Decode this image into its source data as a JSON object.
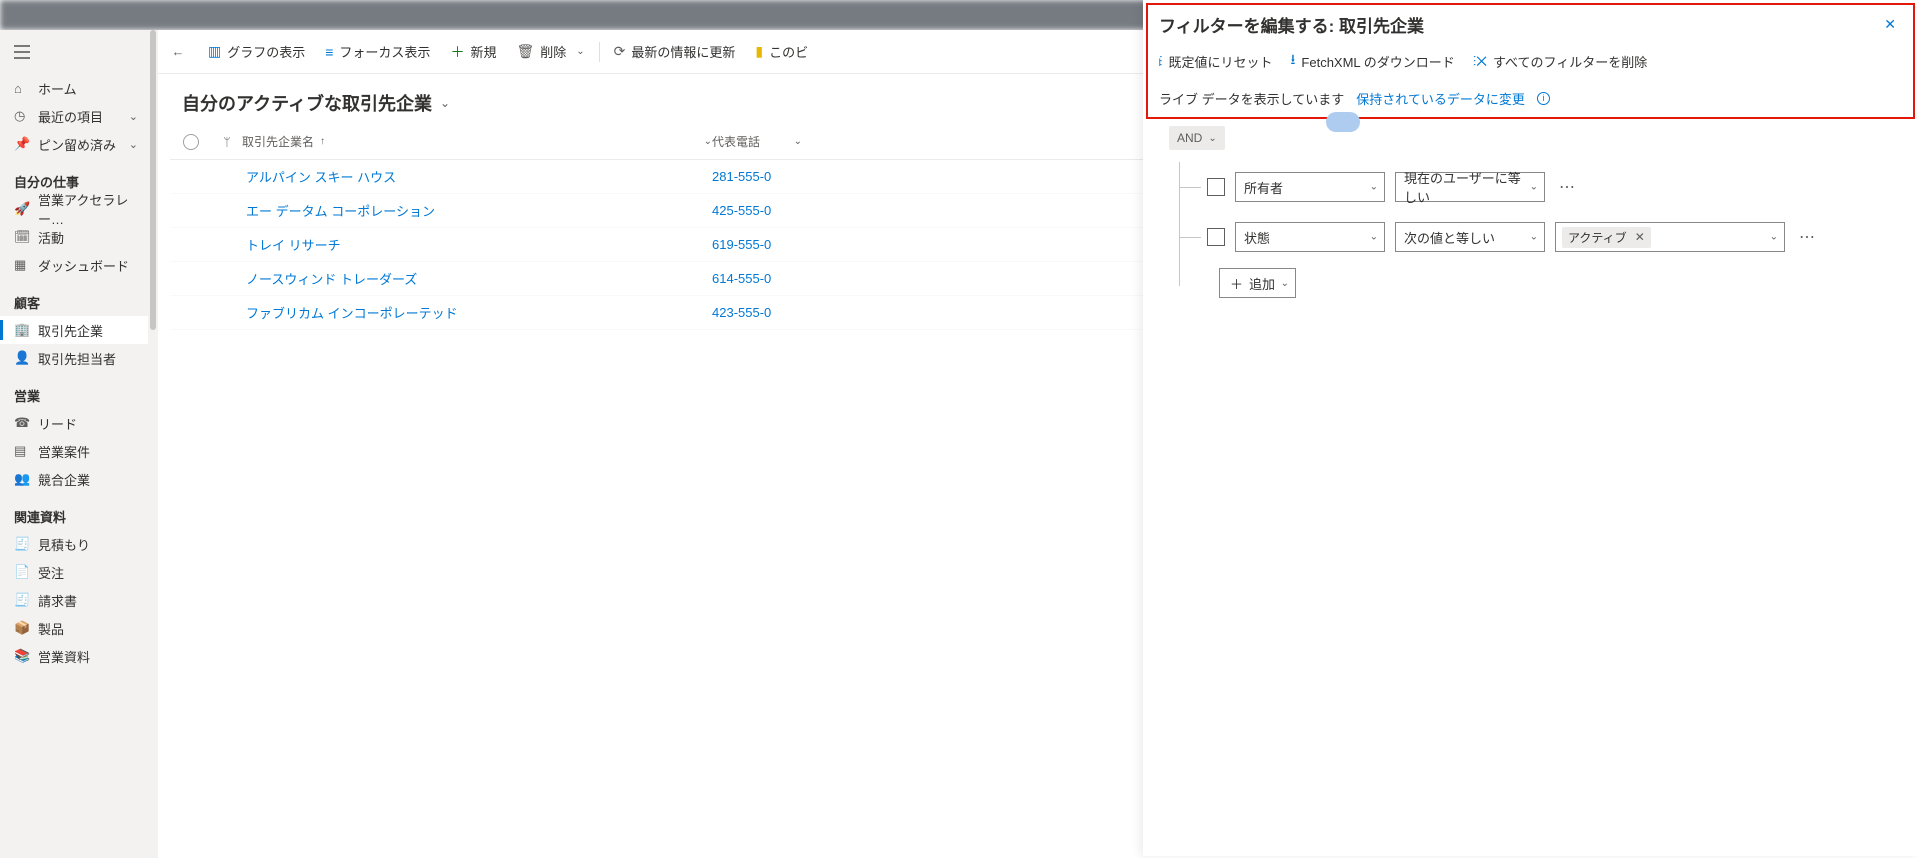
{
  "commandbar": {
    "show_chart": "グラフの表示",
    "focus_view": "フォーカス表示",
    "new": "新規",
    "delete": "削除",
    "refresh": "最新の情報に更新",
    "visualize": "このビ"
  },
  "leftnav": {
    "home": "ホーム",
    "recent": "最近の項目",
    "pinned": "ピン留め済み",
    "section_mywork": "自分の仕事",
    "sales_accel": "営業アクセラレー…",
    "activities": "活動",
    "dashboards": "ダッシュボード",
    "section_customers": "顧客",
    "accounts": "取引先企業",
    "contacts": "取引先担当者",
    "section_sales": "営業",
    "leads": "リード",
    "opportunities": "営業案件",
    "competitors": "競合企業",
    "section_collateral": "関連資料",
    "quotes": "見積もり",
    "orders": "受注",
    "invoices": "請求書",
    "products": "製品",
    "sales_lit": "営業資料"
  },
  "view": {
    "title": "自分のアクティブな取引先企業",
    "col_name": "取引先企業名",
    "col_phone": "代表電話",
    "rows": [
      {
        "name": "アルパイン スキー ハウス",
        "phone": "281-555-0"
      },
      {
        "name": "エー データム コーポレーション",
        "phone": "425-555-0"
      },
      {
        "name": "トレイ リサーチ",
        "phone": "619-555-0"
      },
      {
        "name": "ノースウィンド トレーダーズ",
        "phone": "614-555-0"
      },
      {
        "name": "ファブリカム インコーポレーテッド",
        "phone": "423-555-0"
      }
    ]
  },
  "panel": {
    "title": "フィルターを編集する: 取引先企業",
    "reset": "既定値にリセット",
    "fetchxml": "FetchXML のダウンロード",
    "clear_all": "すべてのフィルターを削除",
    "live_text": "ライブ データを表示しています",
    "retained_link": "保持されているデータに変更",
    "group_op": "AND",
    "cond1_field": "所有者",
    "cond1_op": "現在のユーザーに等しい",
    "cond2_field": "状態",
    "cond2_op": "次の値と等しい",
    "cond2_value": "アクティブ",
    "add": "追加"
  }
}
